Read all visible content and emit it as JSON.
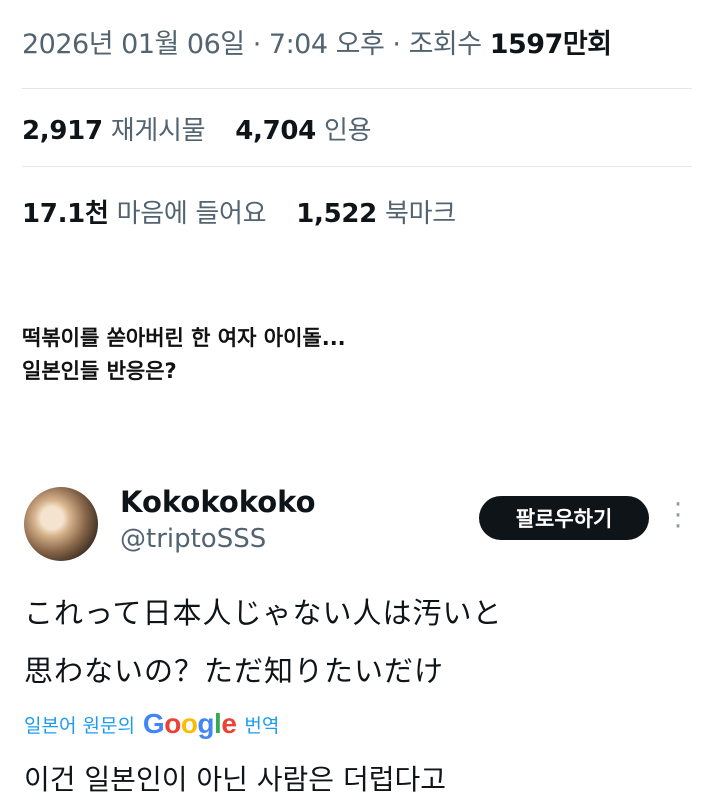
{
  "tweet_meta": {
    "date": "2026년 01월 06일",
    "separator1": "·",
    "time": "7:04 오후",
    "separator2": "·",
    "views_label": "조회수",
    "views_number": "1597",
    "views_unit": "만회"
  },
  "engagement": {
    "reposts_count": "2,917",
    "reposts_label": "재게시물",
    "quotes_count": "4,704",
    "quotes_label": "인용",
    "likes_count": "17.1천",
    "likes_label": "마음에 들어요",
    "bookmarks_count": "1,522",
    "bookmarks_label": "북마크"
  },
  "caption": {
    "line1": "떡볶이를 쏟아버린 한 여자 아이돌...",
    "line2": "일본인들 반응은?"
  },
  "reply": {
    "display_name": "Kokokokoko",
    "handle": "@triptoSSS",
    "follow_label": "팔로우하기",
    "text_line1": "これって日本人じゃない人は汚いと",
    "text_line2": "思わないの？ただ知りたいだけ",
    "translate_prefix": "일본어 원문의",
    "google_letters": [
      "G",
      "o",
      "o",
      "g",
      "l",
      "e"
    ],
    "translate_suffix": "번역",
    "translated_text": "이건 일본인이 아닌 사람은 더럽다고"
  },
  "colors": {
    "text_primary": "#0f1419",
    "text_secondary": "#536471",
    "link_blue": "#1d9bf0",
    "button_bg": "#0f1419"
  },
  "icons": {
    "more": "more-vertical-icon",
    "google": "google-logo"
  }
}
